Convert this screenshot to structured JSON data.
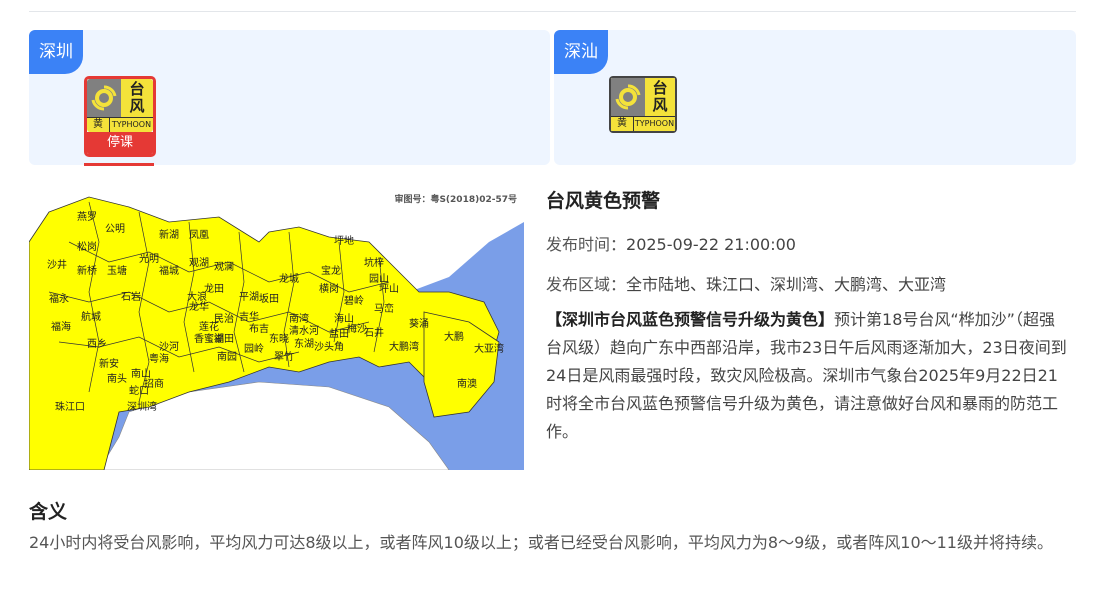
{
  "regions": [
    {
      "name": "深圳",
      "signal": {
        "char1": "台",
        "char2": "风",
        "level": "黄",
        "en": "TYPHOON"
      },
      "status": "停课"
    },
    {
      "name": "深汕",
      "signal": {
        "char1": "台",
        "char2": "风",
        "level": "黄",
        "en": "TYPHOON"
      }
    }
  ],
  "map": {
    "approval_no": "审图号：粤S(2018)02-57号",
    "labels": [
      "燕罗",
      "公明",
      "沙井",
      "松岗",
      "新桥",
      "玉塘",
      "光明",
      "新湖",
      "凤凰",
      "福城",
      "观湖",
      "龙田",
      "坪地",
      "宝龙",
      "坑梓",
      "碧岭",
      "龙城",
      "布吉",
      "平湖",
      "石岩",
      "观澜",
      "大浪",
      "龙华",
      "民治",
      "新安",
      "西乡",
      "航城",
      "福永",
      "福海",
      "吉华",
      "坂田",
      "南湾",
      "东晓",
      "园岭",
      "横岗",
      "园山",
      "马峦",
      "坪山",
      "石井",
      "葵涌",
      "大鹏",
      "南澳",
      "大鹏湾",
      "大亚湾",
      "珠江口",
      "深圳湾",
      "盐田",
      "沙头角",
      "海山",
      "梅沙",
      "东湖",
      "清水河",
      "翠竹",
      "南园",
      "南山",
      "粤海",
      "蛇口",
      "招商",
      "沙河",
      "香蜜湖",
      "莲花",
      "福田",
      "南头"
    ],
    "colors": {
      "land": "#ffff00",
      "sea": "#7a9ee8",
      "hk": "#ffffff"
    }
  },
  "warning": {
    "title": "台风黄色预警",
    "time_label": "发布时间：",
    "time_value": "2025-09-22 21:00:00",
    "area_label": "发布区域：",
    "area_value": "全市陆地、珠江口、深圳湾、大鹏湾、大亚湾",
    "bold_text": "【深圳市台风蓝色预警信号升级为黄色】",
    "body_text": "预计第18号台风“桦加沙”（超强台风级）趋向广东中西部沿岸，我市23日午后风雨逐渐加大，23日夜间到24日是风雨最强时段，致灾风险极高。深圳市气象台2025年9月22日21时将全市台风蓝色预警信号升级为黄色，请注意做好台风和暴雨的防范工作。"
  },
  "meaning": {
    "title": "含义",
    "text": "24小时内将受台风影响，平均风力可达8级以上，或者阵风10级以上；或者已经受台风影响，平均风力为8～9级，或者阵风10～11级并将持续。"
  },
  "colors": {
    "accent": "#3b82f6",
    "alert_red": "#e53935",
    "signal_yellow": "#f4e23a",
    "card_bg": "#eef5ff"
  }
}
